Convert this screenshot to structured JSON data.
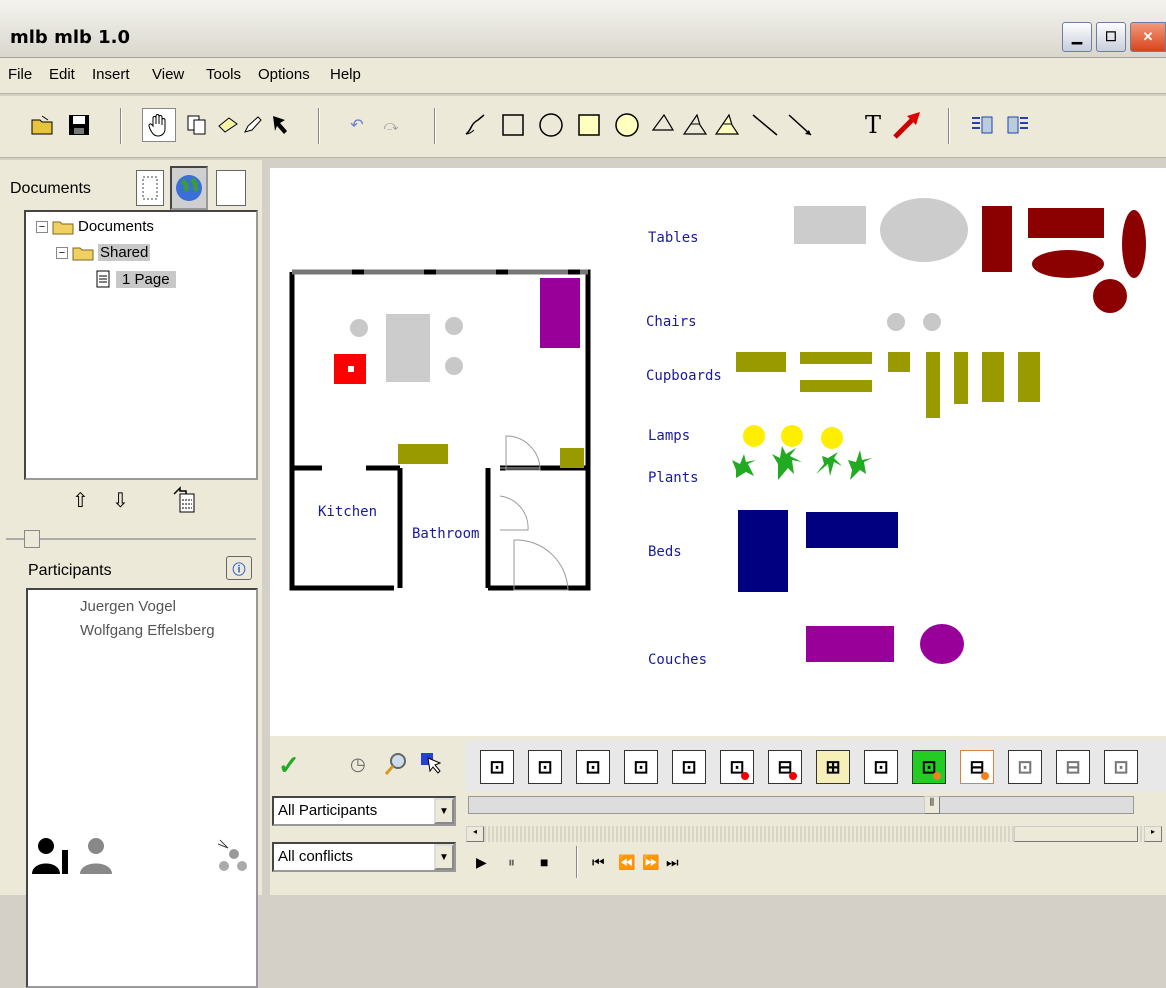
{
  "window": {
    "title": "mlb mlb 1.0"
  },
  "menu": [
    "File",
    "Edit",
    "Insert",
    "View",
    "Tools",
    "Options",
    "Help"
  ],
  "sidebar": {
    "documents_label": "Documents",
    "tree": [
      "Documents",
      "Shared",
      "1 Page"
    ],
    "participants_label": "Participants",
    "participants": [
      "Juergen Vogel",
      "Wolfgang Effelsberg"
    ]
  },
  "canvas": {
    "room_labels": {
      "kitchen": "Kitchen",
      "bathroom": "Bathroom"
    },
    "categories": [
      "Tables",
      "Chairs",
      "Cupboards",
      "Lamps",
      "Plants",
      "Beds",
      "Couches"
    ]
  },
  "bottom": {
    "participant_filter": "All Participants",
    "conflict_filter": "All conflicts"
  },
  "colors": {
    "accent": "#0a246a",
    "brown": "#8b0000",
    "olive": "#999900",
    "purple": "#990099",
    "navy": "#000080"
  }
}
